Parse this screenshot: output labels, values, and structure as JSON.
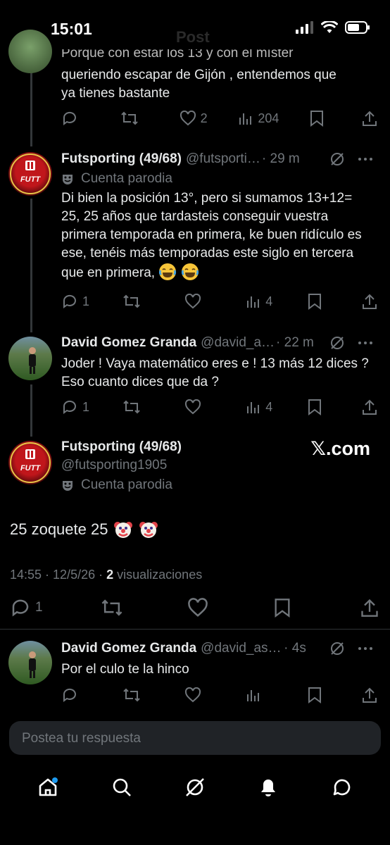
{
  "status": {
    "time": "15:01"
  },
  "header": {
    "title": "Post"
  },
  "colors": {
    "background": "#000000",
    "text": "#e7e9ea",
    "secondary": "#71767b",
    "accent": "#1d9bf0",
    "divider": "#2f3336"
  },
  "tweets": [
    {
      "text_line1": "Porque con estar los 13 y con el míster",
      "text_line2": "queriendo escapar de Gijón , entendemos que",
      "text_line3": "ya tienes bastante",
      "likes": "2",
      "views": "204"
    },
    {
      "name": "Futsporting (49/68)",
      "handle": "@futsporti…",
      "time": "· 29 m",
      "parody": "Cuenta parodia",
      "text": "Di bien la posición 13°, pero si sumamos 13+12= 25, 25 años que tardasteis conseguir vuestra primera temporada en primera, ke buen ridículo es ese, tenéis más temporadas este siglo en tercera que en primera,",
      "replies": "1",
      "views": "4"
    },
    {
      "name": "David Gomez Granda",
      "handle": "@david_a…",
      "time": "· 22 m",
      "text": "Joder ! Vaya matemático eres e !  13 más 12 dices ? Eso cuanto dices que da ?",
      "replies": "1",
      "views": "4"
    }
  ],
  "main": {
    "name": "Futsporting (49/68)",
    "handle": "@futsporting1905",
    "parody": "Cuenta parodia",
    "brand": "𝕏.com",
    "text": "25 zoquete 25",
    "meta_time": "14:55 · 12/5/26 ·",
    "meta_views_count": "2",
    "meta_views_label": "visualizaciones",
    "replies": "1"
  },
  "reply": {
    "name": "David Gomez Granda",
    "handle": "@david_ast1…",
    "time": "· 4s",
    "text": "Por el culo te la hinco"
  },
  "composer": {
    "placeholder": "Postea tu respuesta"
  },
  "nav": [
    "home-icon",
    "search-icon",
    "grok-icon",
    "notifications-icon",
    "messages-icon"
  ]
}
